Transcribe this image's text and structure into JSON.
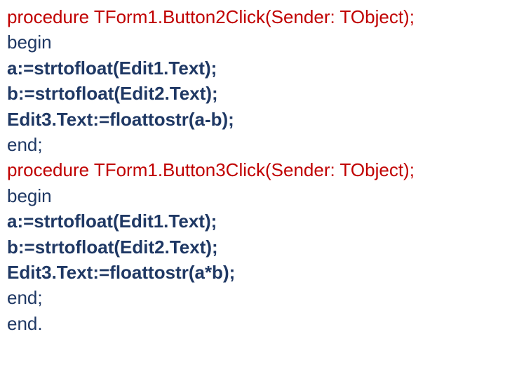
{
  "lines": [
    {
      "cls": "red",
      "text": "procedure TForm1.Button2Click(Sender: TObject);"
    },
    {
      "cls": "navy",
      "text": "begin"
    },
    {
      "cls": "navy-b",
      "text": "a:=strtofloat(Edit1.Text);"
    },
    {
      "cls": "navy-b",
      "text": "b:=strtofloat(Edit2.Text);"
    },
    {
      "cls": "navy-b",
      "text": "Edit3.Text:=floattostr(a-b);"
    },
    {
      "cls": "navy",
      "text": "end;"
    },
    {
      "cls": "red",
      "text": "procedure TForm1.Button3Click(Sender: TObject);"
    },
    {
      "cls": "navy",
      "text": "begin"
    },
    {
      "cls": "navy-b",
      "text": "a:=strtofloat(Edit1.Text);"
    },
    {
      "cls": "navy-b",
      "text": "b:=strtofloat(Edit2.Text);"
    },
    {
      "cls": "navy-b",
      "text": "Edit3.Text:=floattostr(a*b);"
    },
    {
      "cls": "navy",
      "text": "end;"
    },
    {
      "cls": "navy",
      "text": "end."
    }
  ]
}
